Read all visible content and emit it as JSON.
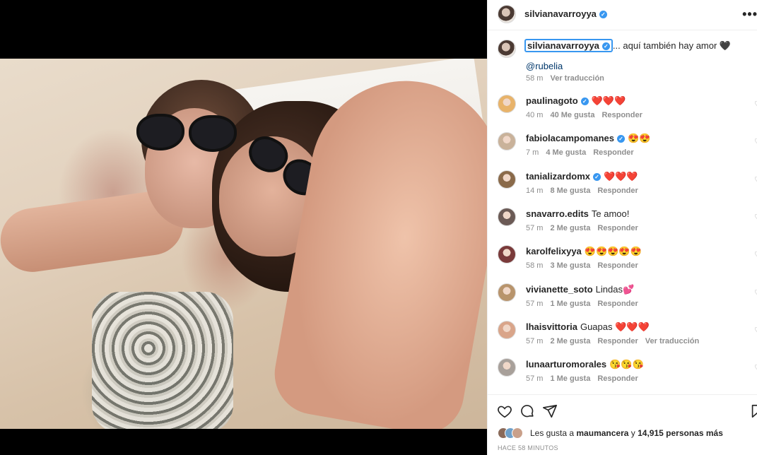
{
  "post": {
    "author": "silvianavarroyya",
    "caption_text": "... aquí también hay amor 🖤",
    "caption_mention": "@rubelia",
    "caption_time": "58 m",
    "caption_translate": "Ver traducción",
    "icons": {
      "more": "more-horizontal-icon",
      "verified": "verified-badge-icon"
    }
  },
  "comments": [
    {
      "user": "paulinagoto",
      "verified": true,
      "text": "❤️❤️❤️",
      "time": "40 m",
      "likes": "40 Me gusta",
      "reply": "Responder",
      "translate": "",
      "avatar_color": "#e8b36a"
    },
    {
      "user": "fabiolacampomanes",
      "verified": true,
      "text": "😍😍",
      "time": "7 m",
      "likes": "4 Me gusta",
      "reply": "Responder",
      "translate": "",
      "avatar_color": "#c9b29a"
    },
    {
      "user": "tanializardomx",
      "verified": true,
      "text": "❤️❤️❤️",
      "time": "14 m",
      "likes": "8 Me gusta",
      "reply": "Responder",
      "translate": "",
      "avatar_color": "#8a6a4a"
    },
    {
      "user": "snavarro.edits",
      "verified": false,
      "text": "Te amoo!",
      "time": "57 m",
      "likes": "2 Me gusta",
      "reply": "Responder",
      "translate": "",
      "avatar_color": "#6b5a55"
    },
    {
      "user": "karolfelixyya",
      "verified": false,
      "text": "😍😍😍😍😍",
      "time": "58 m",
      "likes": "3 Me gusta",
      "reply": "Responder",
      "translate": "",
      "avatar_color": "#7a3a3a"
    },
    {
      "user": "vivianette_soto",
      "verified": false,
      "text": "Lindas💕",
      "time": "57 m",
      "likes": "1 Me gusta",
      "reply": "Responder",
      "translate": "",
      "avatar_color": "#b8946c"
    },
    {
      "user": "lhaisvittoria",
      "verified": false,
      "text": "Guapas ❤️❤️❤️",
      "time": "57 m",
      "likes": "2 Me gusta",
      "reply": "Responder",
      "translate": "Ver traducción",
      "avatar_color": "#d9a58a"
    },
    {
      "user": "lunaarturomorales",
      "verified": false,
      "text": "😘😘😘",
      "time": "57 m",
      "likes": "1 Me gusta",
      "reply": "Responder",
      "translate": "",
      "avatar_color": "#a8a09a"
    }
  ],
  "actions": {
    "icons": [
      "heart-icon",
      "comment-icon",
      "share-icon",
      "bookmark-icon"
    ],
    "likes_prefix": "Les gusta a",
    "likes_user": "maumancera",
    "likes_mid": "y",
    "likes_count": "14,915 personas más",
    "posted": "HACE 58 MINUTOS"
  },
  "colors": {
    "accent": "#3897f0",
    "text": "#262626",
    "muted": "#8e8e8e",
    "link": "#00376b"
  }
}
